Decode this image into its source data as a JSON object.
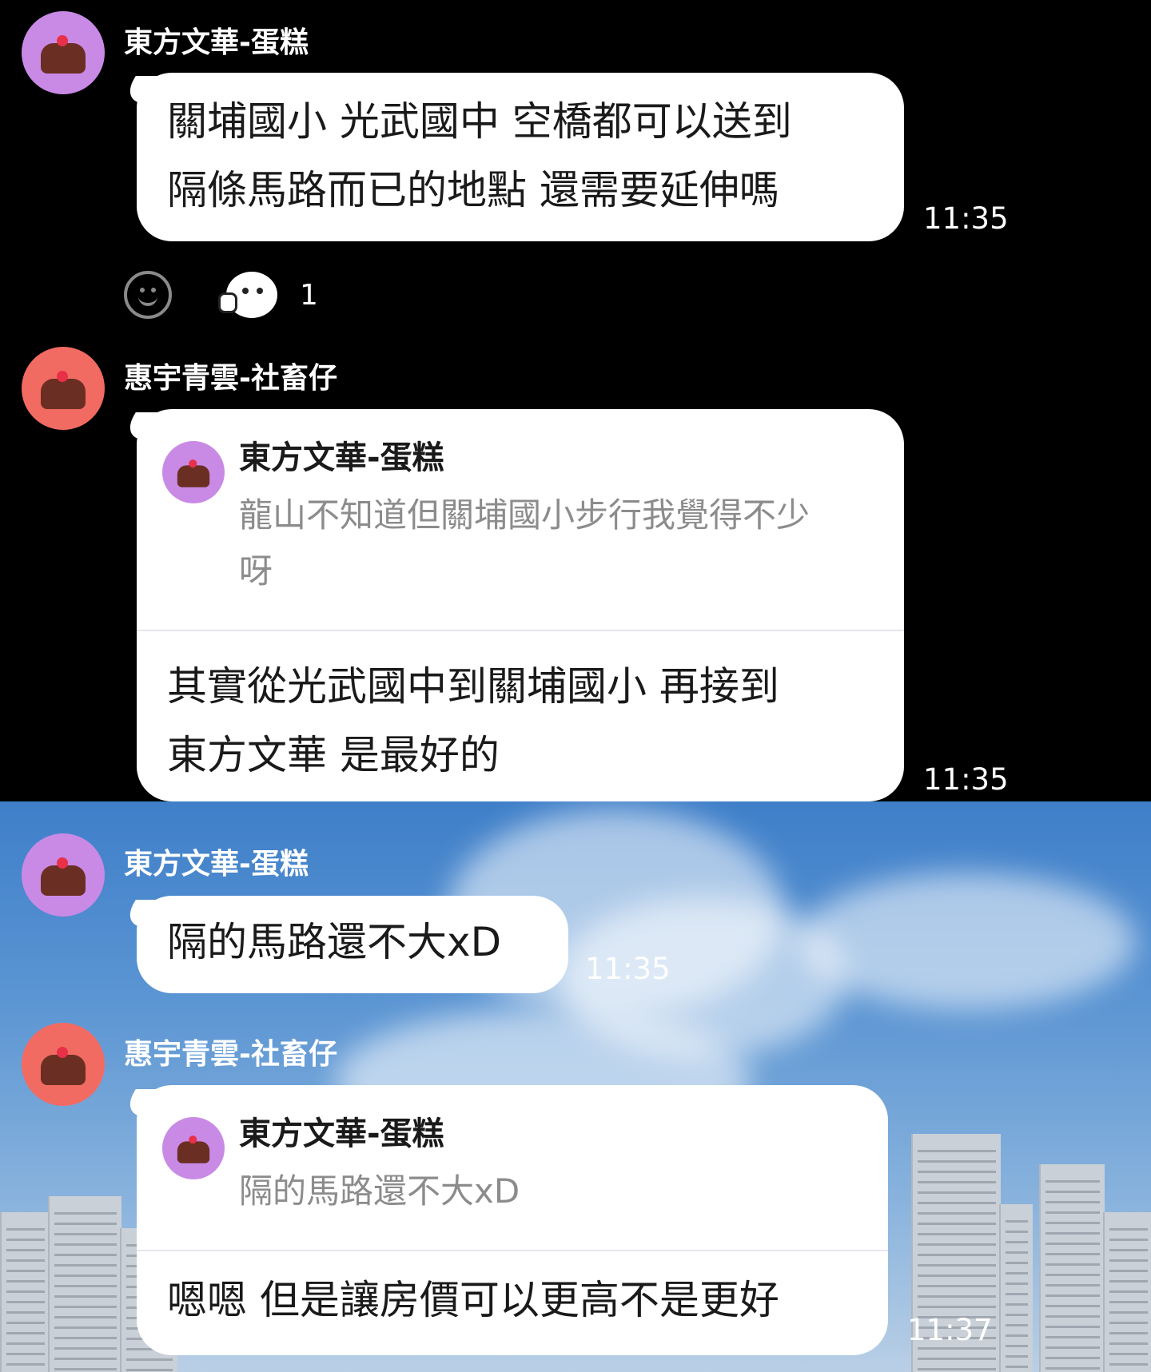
{
  "messages": [
    {
      "sender": "東方文華-蛋糕",
      "lines": [
        "關埔國小 光武國中 空橋都可以送到",
        "隔條馬路而已的地點 還需要延伸嗎"
      ],
      "time": "11:35",
      "reaction": {
        "count": "1",
        "add_icon": "smiley-face-icon",
        "sticker_icon": "thumbs-up-sticker-icon"
      }
    },
    {
      "sender": "惠宇青雲-社畜仔",
      "quote": {
        "sender": "東方文華-蛋糕",
        "lines": [
          "龍山不知道但關埔國小步行我覺得不少",
          "呀"
        ]
      },
      "lines": [
        "其實從光武國中到關埔國小 再接到",
        "東方文華 是最好的"
      ],
      "time": "11:35"
    },
    {
      "sender": "東方文華-蛋糕",
      "lines": [
        "隔的馬路還不大xD"
      ],
      "time": "11:35"
    },
    {
      "sender": "惠宇青雲-社畜仔",
      "quote": {
        "sender": "東方文華-蛋糕",
        "lines": [
          "隔的馬路還不大xD"
        ]
      },
      "lines": [
        "嗯嗯 但是讓房價可以更高不是更好"
      ],
      "time": "11:37"
    }
  ],
  "colors": {
    "avatar_cake_user": "#c98ae6",
    "avatar_office_user": "#f26b63",
    "bubble": "#ffffff",
    "top_background": "#000000",
    "quote_text": "#8c8c8c"
  }
}
